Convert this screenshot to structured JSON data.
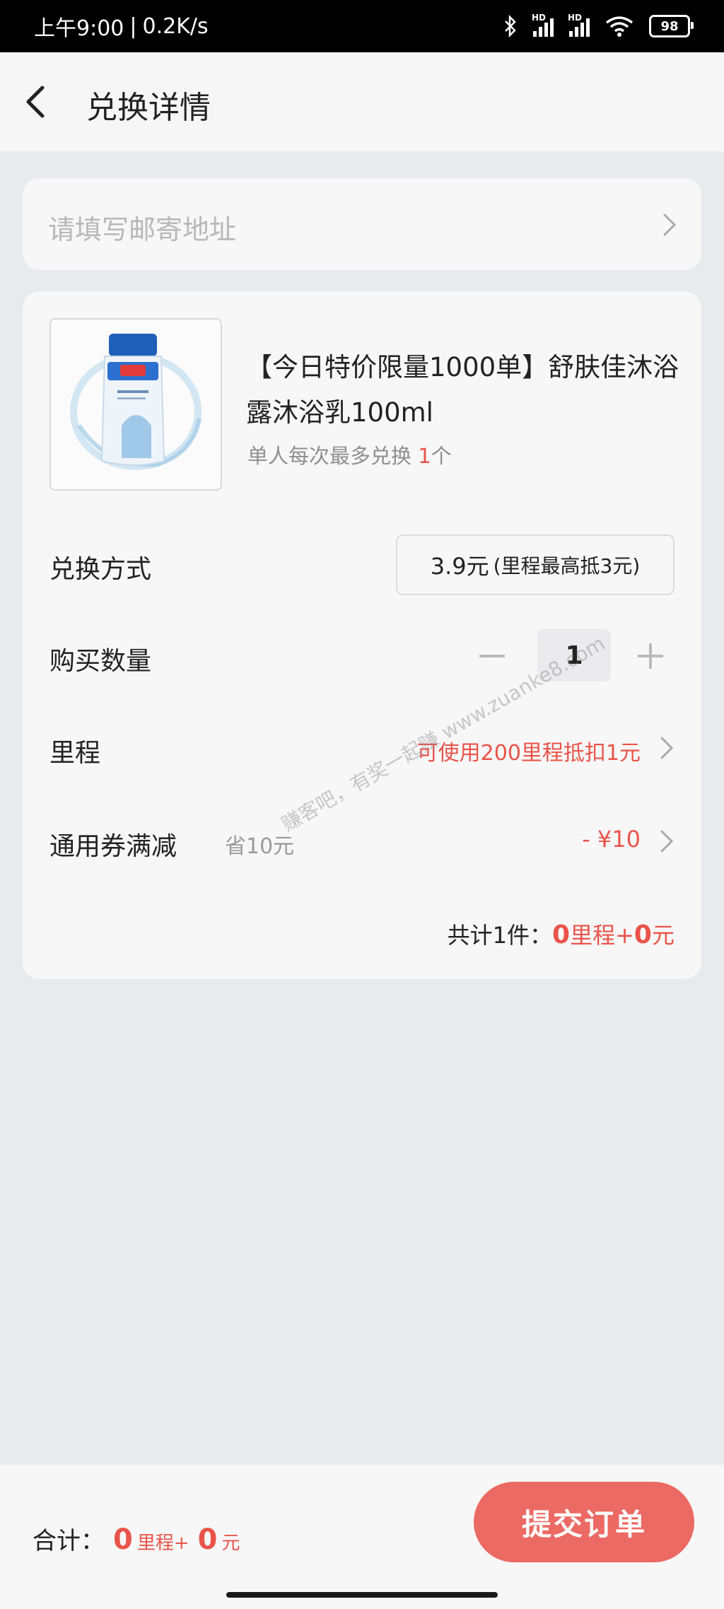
{
  "status_bar": {
    "time": "上午9:00",
    "separator": "|",
    "speed": "0.2K/s",
    "signal_label": "HD",
    "battery": "98"
  },
  "header": {
    "title": "兑换详情"
  },
  "address": {
    "placeholder": "请填写邮寄地址"
  },
  "product": {
    "title": "【今日特价限量1000单】舒肤佳沐浴露沐浴乳100ml",
    "limit_prefix": "单人每次最多兑换 ",
    "limit_num": "1",
    "limit_suffix": "个",
    "image_icon": "body-wash-bottle-icon"
  },
  "rows": {
    "method_label": "兑换方式",
    "method_price": "3.9元",
    "method_note": "(里程最高抵3元)",
    "quantity_label": "购买数量",
    "quantity_value": "1",
    "mileage_label": "里程",
    "mileage_value": "可使用200里程抵扣1元",
    "coupon_label": "通用券满减",
    "coupon_sub": "省10元",
    "coupon_value": "- ¥10"
  },
  "total": {
    "prefix": "共计1件：",
    "mileage_num": "0",
    "mileage_unit": "里程+",
    "yuan_num": "0",
    "yuan_unit": "元"
  },
  "watermark": "赚客吧，有奖一起赚 www.zuanke8.com",
  "bottom": {
    "sum_label": "合计：",
    "mileage_num": "0",
    "mileage_unit": "里程+",
    "yuan_num": "0",
    "yuan_unit": "元",
    "submit_label": "提交订单"
  },
  "colors": {
    "accent": "#e9544a",
    "button": "#ec6a64",
    "background": "#e8eaee",
    "card": "#f7f7f7"
  }
}
